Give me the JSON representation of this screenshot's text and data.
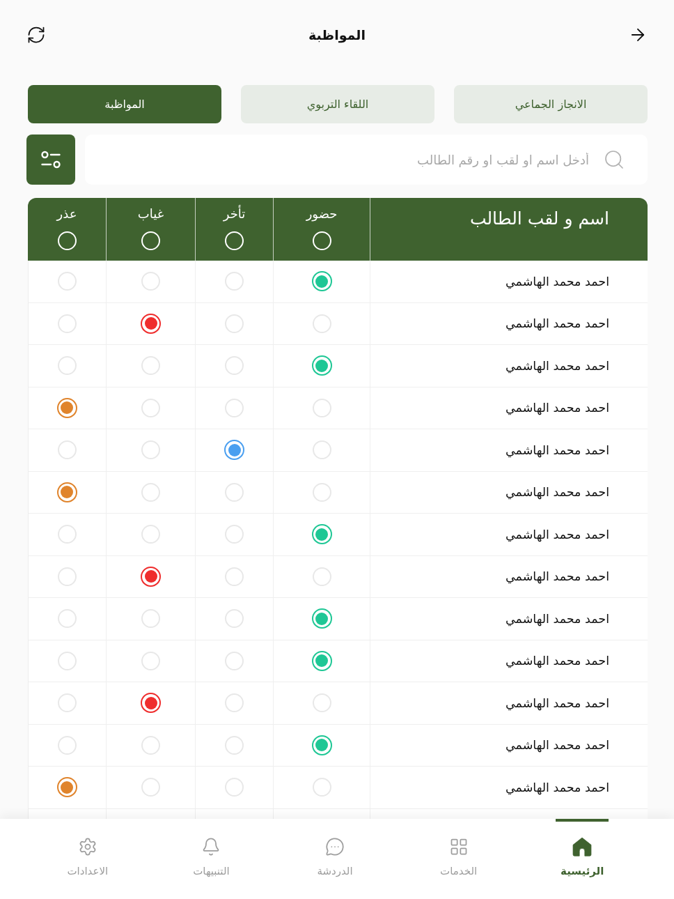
{
  "header": {
    "title": "المواظبة"
  },
  "tabs": [
    {
      "label": "الانجاز الجماعي",
      "selected": false
    },
    {
      "label": "اللقاء التربوي",
      "selected": false
    },
    {
      "label": "المواظبة",
      "selected": true
    }
  ],
  "search": {
    "placeholder": "أدخل اسم او لقب او رقم الطالب"
  },
  "table": {
    "columns": [
      {
        "label": "اسم و لقب الطالب",
        "kind": "name"
      },
      {
        "label": "حضور",
        "kind": "status",
        "color": "#1fc795",
        "selected": false
      },
      {
        "label": "تأخر",
        "kind": "status",
        "color": "#4a9ff0",
        "selected": false
      },
      {
        "label": "غياب",
        "kind": "status",
        "color": "#ef2d2d",
        "selected": false
      },
      {
        "label": "عذر",
        "kind": "status",
        "color": "#e0842c",
        "selected": false
      }
    ],
    "rows": [
      {
        "name": "احمد محمد الهاشمي",
        "options": [
          {
            "selected": true
          },
          {
            "selected": false
          },
          {
            "selected": false
          },
          {
            "selected": false
          }
        ]
      },
      {
        "name": "احمد محمد الهاشمي",
        "options": [
          {
            "selected": false
          },
          {
            "selected": false
          },
          {
            "selected": true
          },
          {
            "selected": false
          }
        ]
      },
      {
        "name": "احمد محمد الهاشمي",
        "options": [
          {
            "selected": true
          },
          {
            "selected": false
          },
          {
            "selected": false
          },
          {
            "selected": false
          }
        ]
      },
      {
        "name": "احمد محمد الهاشمي",
        "options": [
          {
            "selected": false
          },
          {
            "selected": false
          },
          {
            "selected": false
          },
          {
            "selected": true
          }
        ]
      },
      {
        "name": "احمد محمد الهاشمي",
        "options": [
          {
            "selected": false
          },
          {
            "selected": true
          },
          {
            "selected": false
          },
          {
            "selected": false
          }
        ]
      },
      {
        "name": "احمد محمد الهاشمي",
        "options": [
          {
            "selected": false
          },
          {
            "selected": false
          },
          {
            "selected": false
          },
          {
            "selected": true
          }
        ]
      },
      {
        "name": "احمد محمد الهاشمي",
        "options": [
          {
            "selected": true
          },
          {
            "selected": false
          },
          {
            "selected": false
          },
          {
            "selected": false
          }
        ]
      },
      {
        "name": "احمد محمد الهاشمي",
        "options": [
          {
            "selected": false
          },
          {
            "selected": false
          },
          {
            "selected": true
          },
          {
            "selected": false
          }
        ]
      },
      {
        "name": "احمد محمد الهاشمي",
        "options": [
          {
            "selected": true
          },
          {
            "selected": false
          },
          {
            "selected": false
          },
          {
            "selected": false
          }
        ]
      },
      {
        "name": "احمد محمد الهاشمي",
        "options": [
          {
            "selected": true
          },
          {
            "selected": false
          },
          {
            "selected": false
          },
          {
            "selected": false
          }
        ]
      },
      {
        "name": "احمد محمد الهاشمي",
        "options": [
          {
            "selected": false
          },
          {
            "selected": false
          },
          {
            "selected": true
          },
          {
            "selected": false
          }
        ]
      },
      {
        "name": "احمد محمد الهاشمي",
        "options": [
          {
            "selected": true
          },
          {
            "selected": false
          },
          {
            "selected": false
          },
          {
            "selected": false
          }
        ]
      },
      {
        "name": "احمد محمد الهاشمي",
        "options": [
          {
            "selected": false
          },
          {
            "selected": false
          },
          {
            "selected": false
          },
          {
            "selected": true
          }
        ]
      }
    ]
  },
  "bottom_nav": [
    {
      "label": "الرئيسية",
      "selected": true
    },
    {
      "label": "الخدمات",
      "selected": false
    },
    {
      "label": "الدردشة",
      "selected": false
    },
    {
      "label": "التنبيهات",
      "selected": false
    },
    {
      "label": "الاعدادات",
      "selected": false
    }
  ]
}
